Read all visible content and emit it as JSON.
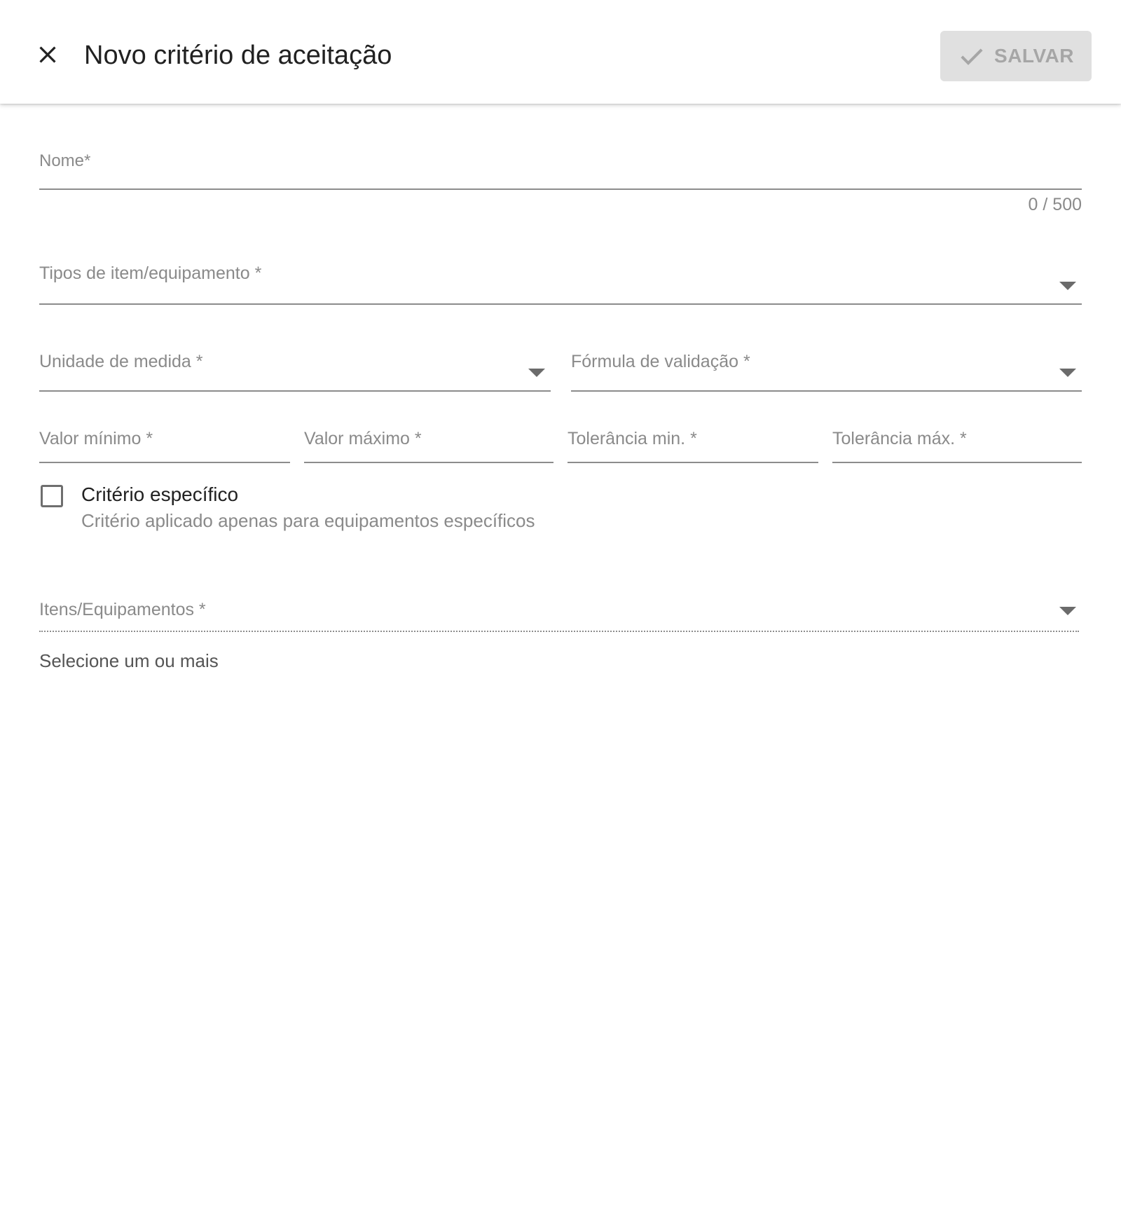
{
  "header": {
    "title": "Novo critério de aceitação",
    "save_label": "SALVAR"
  },
  "form": {
    "nome": {
      "label": "Nome*",
      "value": "",
      "counter": "0 / 500"
    },
    "tipos": {
      "label": "Tipos de item/equipamento *",
      "value": ""
    },
    "unidade": {
      "label": "Unidade de medida *",
      "value": ""
    },
    "formula": {
      "label": "Fórmula de validação *",
      "value": ""
    },
    "valor_minimo": {
      "label": "Valor mínimo *",
      "value": ""
    },
    "valor_maximo": {
      "label": "Valor máximo *",
      "value": ""
    },
    "tolerancia_min": {
      "label": "Tolerância min. *",
      "value": ""
    },
    "tolerancia_max": {
      "label": "Tolerância máx. *",
      "value": ""
    },
    "criterio_especifico": {
      "label": "Critério específico",
      "hint": "Critério aplicado apenas para equipamentos específicos",
      "checked": false
    },
    "itens": {
      "label": "Itens/Equipamentos *",
      "helper": "Selecione um ou mais",
      "disabled": true
    }
  },
  "colors": {
    "save_bg": "#e0e0e0",
    "save_text": "#a6a6a6",
    "label_gray": "#8a8a8a",
    "title_text": "#212121"
  },
  "icons": {
    "close": "close-icon",
    "save": "check-icon",
    "dropdown": "arrow-drop-down-icon"
  }
}
